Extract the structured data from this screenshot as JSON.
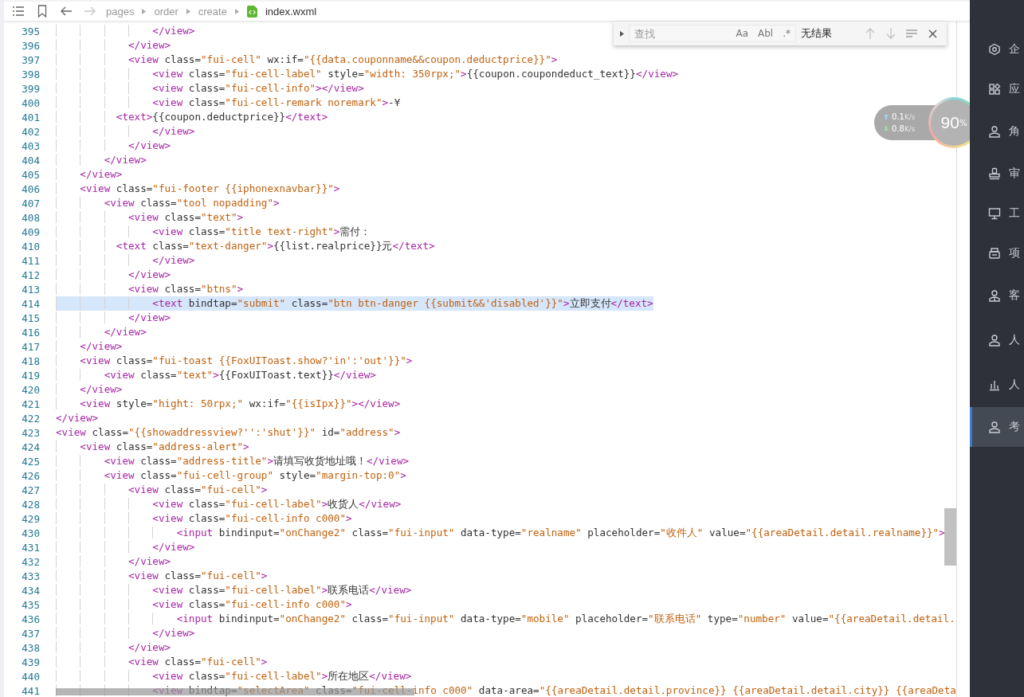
{
  "toolbar": {
    "breadcrumb": [
      "pages",
      "order",
      "create"
    ],
    "file": "index.wxml"
  },
  "find": {
    "placeholder": "查找",
    "options": [
      "Aa",
      "Abl",
      ".*"
    ],
    "result": "无结果"
  },
  "lines": [
    {
      "number": "395",
      "code": "                </view>",
      "highlighted": false
    },
    {
      "number": "396",
      "code": "            </view>",
      "highlighted": false
    },
    {
      "number": "397",
      "code": "            <view class=\"fui-cell\" wx:if=\"{{data.couponname&&coupon.deductprice}}\">",
      "highlighted": false
    },
    {
      "number": "398",
      "code": "                <view class=\"fui-cell-label\" style=\"width: 350rpx;\">{{coupon.coupondeduct_text}}</view>",
      "highlighted": false
    },
    {
      "number": "399",
      "code": "                <view class=\"fui-cell-info\"></view>",
      "highlighted": false
    },
    {
      "number": "400",
      "code": "                <view class=\"fui-cell-remark noremark\">-¥",
      "highlighted": false
    },
    {
      "number": "401",
      "code": "          <text>{{coupon.deductprice}}</text>",
      "highlighted": false
    },
    {
      "number": "402",
      "code": "                </view>",
      "highlighted": false
    },
    {
      "number": "403",
      "code": "            </view>",
      "highlighted": false
    },
    {
      "number": "404",
      "code": "        </view>",
      "highlighted": false
    },
    {
      "number": "405",
      "code": "    </view>",
      "highlighted": false
    },
    {
      "number": "406",
      "code": "    <view class=\"fui-footer {{iphonexnavbar}}\">",
      "highlighted": false
    },
    {
      "number": "407",
      "code": "        <view class=\"tool nopadding\">",
      "highlighted": false
    },
    {
      "number": "408",
      "code": "            <view class=\"text\">",
      "highlighted": false
    },
    {
      "number": "409",
      "code": "                <view class=\"title text-right\">需付：",
      "highlighted": false
    },
    {
      "number": "410",
      "code": "          <text class=\"text-danger\">{{list.realprice}}元</text>",
      "highlighted": false
    },
    {
      "number": "411",
      "code": "                </view>",
      "highlighted": false
    },
    {
      "number": "412",
      "code": "            </view>",
      "highlighted": false
    },
    {
      "number": "413",
      "code": "            <view class=\"btns\">",
      "highlighted": false
    },
    {
      "number": "414",
      "code": "                <text bindtap=\"submit\" class=\"btn btn-danger {{submit&&'disabled'}}\">立即支付</text>",
      "highlighted": true
    },
    {
      "number": "415",
      "code": "            </view>",
      "highlighted": false
    },
    {
      "number": "416",
      "code": "        </view>",
      "highlighted": false
    },
    {
      "number": "417",
      "code": "    </view>",
      "highlighted": false
    },
    {
      "number": "418",
      "code": "    <view class=\"fui-toast {{FoxUIToast.show?'in':'out'}}\">",
      "highlighted": false
    },
    {
      "number": "419",
      "code": "        <view class=\"text\">{{FoxUIToast.text}}</view>",
      "highlighted": false
    },
    {
      "number": "420",
      "code": "    </view>",
      "highlighted": false
    },
    {
      "number": "421",
      "code": "    <view style=\"hight: 50rpx;\" wx:if=\"{{isIpx}}\"></view>",
      "highlighted": false
    },
    {
      "number": "422",
      "code": "</view>",
      "highlighted": false
    },
    {
      "number": "423",
      "code": "<view class=\"{{showaddressview?'':'shut'}}\" id=\"address\">",
      "highlighted": false
    },
    {
      "number": "424",
      "code": "    <view class=\"address-alert\">",
      "highlighted": false
    },
    {
      "number": "425",
      "code": "        <view class=\"address-title\">请填写收货地址哦！</view>",
      "highlighted": false
    },
    {
      "number": "426",
      "code": "        <view class=\"fui-cell-group\" style=\"margin-top:0\">",
      "highlighted": false
    },
    {
      "number": "427",
      "code": "            <view class=\"fui-cell\">",
      "highlighted": false
    },
    {
      "number": "428",
      "code": "                <view class=\"fui-cell-label\">收货人</view>",
      "highlighted": false
    },
    {
      "number": "429",
      "code": "                <view class=\"fui-cell-info c000\">",
      "highlighted": false
    },
    {
      "number": "430",
      "code": "                    <input bindinput=\"onChange2\" class=\"fui-input\" data-type=\"realname\" placeholder=\"收件人\" value=\"{{areaDetail.detail.realname}}\">",
      "highlighted": false
    },
    {
      "number": "431",
      "code": "                </view>",
      "highlighted": false
    },
    {
      "number": "432",
      "code": "            </view>",
      "highlighted": false
    },
    {
      "number": "433",
      "code": "            <view class=\"fui-cell\">",
      "highlighted": false
    },
    {
      "number": "434",
      "code": "                <view class=\"fui-cell-label\">联系电话</view>",
      "highlighted": false
    },
    {
      "number": "435",
      "code": "                <view class=\"fui-cell-info c000\">",
      "highlighted": false
    },
    {
      "number": "436",
      "code": "                    <input bindinput=\"onChange2\" class=\"fui-input\" data-type=\"mobile\" placeholder=\"联系电话\" type=\"number\" value=\"{{areaDetail.detail.",
      "highlighted": false
    },
    {
      "number": "437",
      "code": "                </view>",
      "highlighted": false
    },
    {
      "number": "438",
      "code": "            </view>",
      "highlighted": false
    },
    {
      "number": "439",
      "code": "            <view class=\"fui-cell\">",
      "highlighted": false
    },
    {
      "number": "440",
      "code": "                <view class=\"fui-cell-label\">所在地区</view>",
      "highlighted": false
    },
    {
      "number": "441",
      "code": "                <view bindtap=\"selectArea\" class=\"fui-cell-info c000\" data-area=\"{{areaDetail.detail.province}} {{areaDetail.detail.city}} {{areaDeta",
      "highlighted": false
    }
  ],
  "net_monitor": {
    "upload": {
      "value": "0.1",
      "unit": "K/s"
    },
    "download": {
      "value": "0.8",
      "unit": "K/s"
    },
    "percent": "90",
    "percent_sign": "%"
  },
  "sidebar": {
    "items": [
      {
        "label": "企",
        "selected": false
      },
      {
        "label": "应",
        "selected": false
      },
      {
        "label": "角",
        "selected": false
      },
      {
        "label": "审",
        "selected": false
      },
      {
        "label": "工",
        "selected": false
      },
      {
        "label": "项",
        "selected": false
      },
      {
        "label": "客",
        "selected": false
      },
      {
        "label": "人",
        "selected": false
      },
      {
        "label": "人",
        "selected": false
      },
      {
        "label": "考",
        "selected": true
      }
    ]
  }
}
